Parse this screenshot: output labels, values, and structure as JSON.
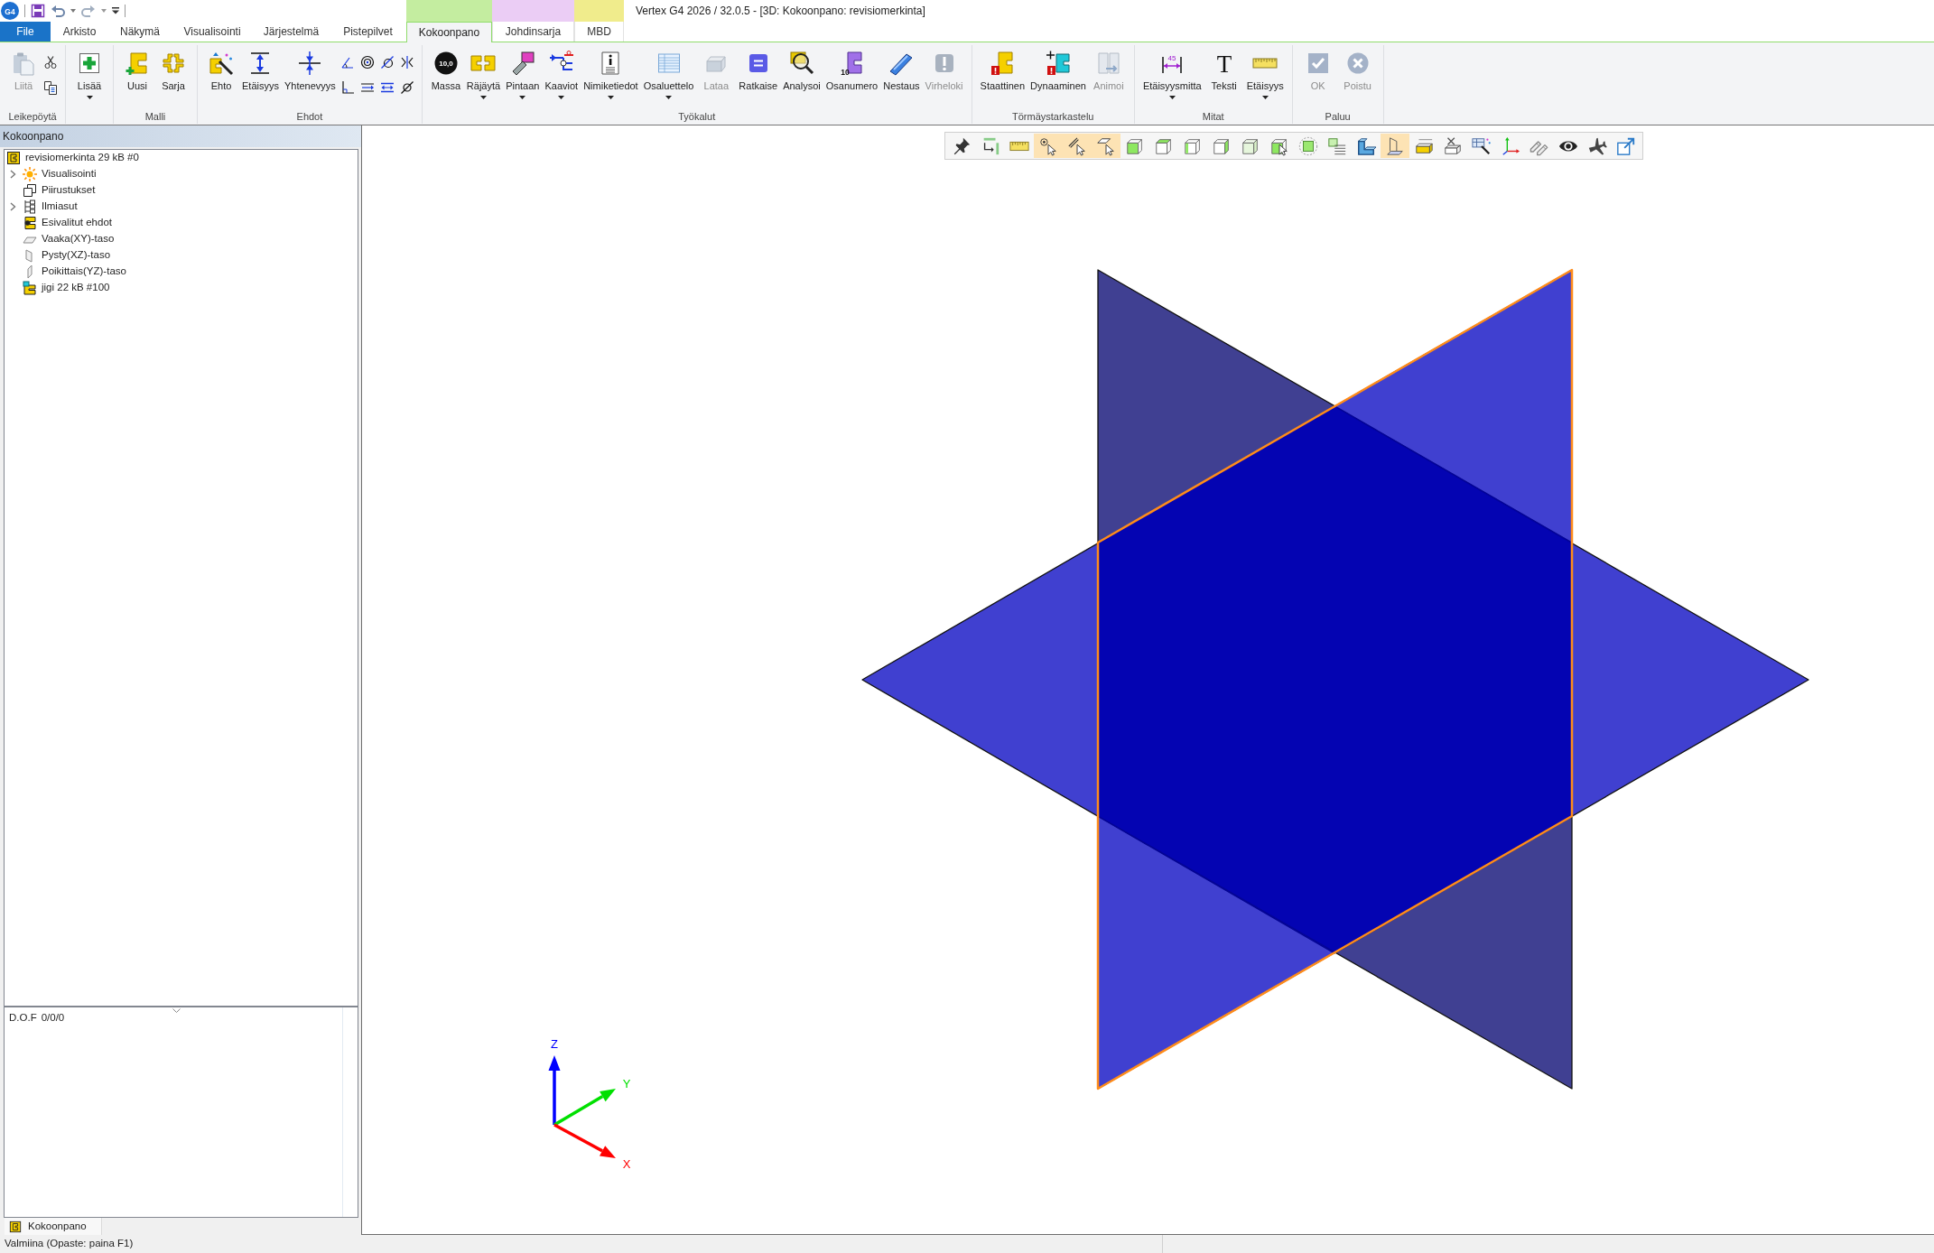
{
  "quick_access": {
    "logo": "G4"
  },
  "window": {
    "title": "Vertex G4 2026 / 32.0.5 - [3D: Kokoonpano: revisiomerkinta]"
  },
  "tabs": [
    {
      "label": "File",
      "kind": "file",
      "selected": false
    },
    {
      "label": "Arkisto",
      "kind": "tab",
      "selected": false
    },
    {
      "label": "Näkymä",
      "kind": "tab",
      "selected": false
    },
    {
      "label": "Visualisointi",
      "kind": "tab",
      "selected": false
    },
    {
      "label": "Järjestelmä",
      "kind": "tab",
      "selected": false
    },
    {
      "label": "Pistepilvet",
      "kind": "tab",
      "selected": false
    },
    {
      "label": "Kokoonpano",
      "kind": "tab",
      "selected": true,
      "color": "#c4eda0"
    },
    {
      "label": "Johdinsarja",
      "kind": "tab",
      "selected": false,
      "color": "#ebcdf5"
    },
    {
      "label": "MBD",
      "kind": "tab",
      "selected": false,
      "color": "#f0ec8c"
    }
  ],
  "ribbon": {
    "groups": [
      {
        "label": "Leikepöytä",
        "buttons": [
          {
            "label": "Liitä",
            "disabled": true,
            "dropdown": false
          }
        ],
        "small_buttons": [
          {
            "disabled": false
          },
          {
            "disabled": false
          }
        ]
      },
      {
        "buttons": [
          {
            "label": "Lisää",
            "disabled": false,
            "dropdown": true
          }
        ]
      },
      {
        "label": "Malli",
        "buttons": [
          {
            "label": "Uusi",
            "disabled": false,
            "dropdown": false
          },
          {
            "label": "Sarja",
            "disabled": false,
            "dropdown": false
          }
        ]
      },
      {
        "label": "Ehdot",
        "buttons": [
          {
            "label": "Ehto",
            "disabled": false,
            "dropdown": false
          },
          {
            "label": "Etäisyys",
            "disabled": false,
            "dropdown": false
          },
          {
            "label": "Yhtenevyys",
            "disabled": false,
            "dropdown": false
          }
        ],
        "small_buttons": [
          {
            "disabled": false
          },
          {
            "disabled": false
          },
          {
            "disabled": false
          },
          {
            "disabled": false
          },
          {
            "disabled": false
          },
          {
            "disabled": false
          },
          {
            "disabled": false
          },
          {
            "disabled": false
          }
        ]
      },
      {
        "label": "Työkalut",
        "buttons": [
          {
            "label": "Massa",
            "icon_text": "10,0",
            "disabled": false,
            "dropdown": false
          },
          {
            "label": "Räjäytä",
            "disabled": false,
            "dropdown": true
          },
          {
            "label": "Pintaan",
            "disabled": false,
            "dropdown": true
          },
          {
            "label": "Kaaviot",
            "disabled": false,
            "dropdown": true
          },
          {
            "label": "Nimiketiedot",
            "disabled": false,
            "dropdown": true
          },
          {
            "label": "Osaluettelo",
            "disabled": false,
            "dropdown": true
          },
          {
            "label": "Lataa",
            "disabled": true,
            "dropdown": false
          },
          {
            "label": "Ratkaise",
            "disabled": false,
            "dropdown": false
          },
          {
            "label": "Analysoi",
            "disabled": false,
            "dropdown": false
          },
          {
            "label": "Osanumero",
            "icon_text": "10",
            "disabled": false,
            "dropdown": false
          },
          {
            "label": "Nestaus",
            "disabled": false,
            "dropdown": false
          },
          {
            "label": "Virheloki",
            "disabled": true,
            "dropdown": false
          }
        ]
      },
      {
        "label": "Törmäystarkastelu",
        "buttons": [
          {
            "label": "Staattinen",
            "disabled": false,
            "dropdown": false
          },
          {
            "label": "Dynaaminen",
            "disabled": false,
            "dropdown": false
          },
          {
            "label": "Animoi",
            "disabled": true,
            "dropdown": false
          }
        ]
      },
      {
        "label": "Mitat",
        "buttons": [
          {
            "label": "Etäisyysmitta",
            "icon_text": "45",
            "disabled": false,
            "dropdown": true
          },
          {
            "label": "Teksti",
            "icon_text": "T",
            "disabled": false,
            "dropdown": false
          },
          {
            "label": "Etäisyys",
            "disabled": false,
            "dropdown": true
          }
        ]
      },
      {
        "label": "Paluu",
        "buttons": [
          {
            "label": "OK",
            "disabled": true,
            "dropdown": false
          },
          {
            "label": "Poistu",
            "disabled": true,
            "dropdown": false
          }
        ]
      }
    ]
  },
  "tree_panel": {
    "title": "Kokoonpano",
    "items": [
      {
        "label": "revisiomerkinta 29 kB #0",
        "kind": "assembly",
        "children": [
          {
            "label": "Visualisointi",
            "kind": "lighting",
            "expanded": false
          },
          {
            "label": "Piirustukset",
            "kind": "drawings"
          },
          {
            "label": "Ilmiasut",
            "kind": "appearances",
            "expanded": false
          },
          {
            "label": "Esivalitut ehdot",
            "kind": "constraints"
          },
          {
            "label": "Vaaka(XY)-taso",
            "kind": "horizontal"
          },
          {
            "label": "Pysty(XZ)-taso",
            "kind": "vertical"
          },
          {
            "label": "Poikittais(YZ)-taso",
            "kind": "transverse"
          },
          {
            "label": "jigi 22 kB #100",
            "kind": "part"
          }
        ]
      }
    ]
  },
  "dof_panel": {
    "label": "D.O.F",
    "value": "0/0/0"
  },
  "panel_tabs": [
    {
      "label": "Kokoonpano",
      "selected": true
    }
  ],
  "viewport": {
    "toolbar": [
      {
        "selected": false
      },
      {
        "selected": false
      },
      {
        "selected": false
      },
      {
        "selected": true
      },
      {
        "selected": true
      },
      {
        "selected": true
      },
      {
        "selected": false
      },
      {
        "selected": false
      },
      {
        "selected": false
      },
      {
        "selected": false
      },
      {
        "selected": false
      },
      {
        "selected": false
      },
      {
        "selected": false
      },
      {
        "selected": false
      },
      {
        "selected": false
      },
      {
        "selected": true
      },
      {
        "selected": false
      },
      {
        "selected": false
      },
      {
        "selected": false
      },
      {
        "selected": false
      },
      {
        "selected": false
      },
      {
        "selected": false
      },
      {
        "selected": false
      },
      {
        "selected": false
      }
    ],
    "planes": [
      {
        "kind": "xy",
        "highlighted": false
      },
      {
        "kind": "xz",
        "highlighted": false
      },
      {
        "kind": "yz",
        "highlighted": true
      }
    ],
    "axes": [
      {
        "kind": "z",
        "label": "Z",
        "color": "#0000ff"
      },
      {
        "kind": "y",
        "label": "Y",
        "color": "#00e000"
      },
      {
        "kind": "x",
        "label": "X",
        "color": "#ff0000"
      }
    ]
  },
  "status_bar": {
    "text": "Valmiina (Opaste: paina F1)"
  }
}
